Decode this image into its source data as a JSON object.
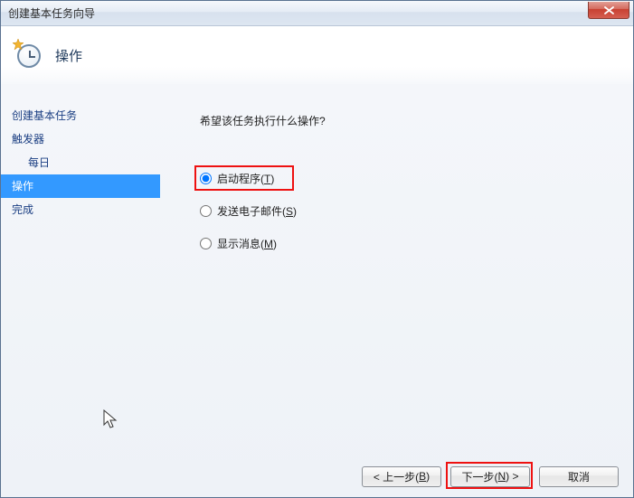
{
  "window": {
    "title": "创建基本任务向导"
  },
  "header": {
    "title": "操作"
  },
  "sidebar": {
    "items": [
      {
        "label": "创建基本任务",
        "indent": false,
        "active": false
      },
      {
        "label": "触发器",
        "indent": false,
        "active": false
      },
      {
        "label": "每日",
        "indent": true,
        "active": false
      },
      {
        "label": "操作",
        "indent": false,
        "active": true
      },
      {
        "label": "完成",
        "indent": false,
        "active": false
      }
    ]
  },
  "content": {
    "prompt": "希望该任务执行什么操作?",
    "options": [
      {
        "label_pre": "启动程序(",
        "shortcut": "T",
        "label_post": ")",
        "checked": true
      },
      {
        "label_pre": "发送电子邮件(",
        "shortcut": "S",
        "label_post": ")",
        "checked": false
      },
      {
        "label_pre": "显示消息(",
        "shortcut": "M",
        "label_post": ")",
        "checked": false
      }
    ]
  },
  "footer": {
    "back_pre": "< 上一步(",
    "back_sc": "B",
    "back_post": ")",
    "next_pre": "下一步(",
    "next_sc": "N",
    "next_post": ") >",
    "cancel": "取消"
  }
}
